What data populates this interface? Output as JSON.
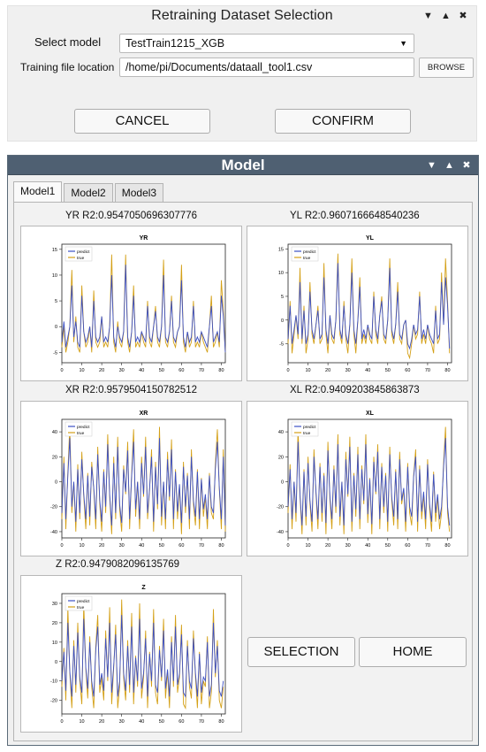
{
  "dataset_window": {
    "title": "Retraining Dataset Selection",
    "select_model_label": "Select model",
    "selected_model": "TestTrain1215_XGB",
    "training_file_label": "Training file location",
    "training_file_value": "/home/pi/Documents/dataall_tool1.csv",
    "browse_label": "BROWSE",
    "cancel_label": "CANCEL",
    "confirm_label": "CONFIRM",
    "window_controls": [
      "chevron-down-icon",
      "chevron-up-icon",
      "close-icon"
    ]
  },
  "model_window": {
    "title": "Model",
    "window_controls": [
      "chevron-down-icon",
      "chevron-up-icon",
      "close-icon"
    ],
    "tabs": [
      {
        "label": "Model1",
        "active": true
      },
      {
        "label": "Model2",
        "active": false
      },
      {
        "label": "Model3",
        "active": false
      }
    ],
    "panels": [
      {
        "r2_label": "YR  R2:0.9547050696307776"
      },
      {
        "r2_label": "YL  R2:0.9607166648540236"
      },
      {
        "r2_label": "XR  R2:0.9579504150782512"
      },
      {
        "r2_label": "XL  R2:0.9409203845863873"
      },
      {
        "r2_label": "Z  R2:0.9479082096135769"
      }
    ],
    "selection_label": "SELECTION",
    "home_label": "HOME"
  },
  "colors": {
    "predict": "#3b4fc4",
    "true": "#d4a017",
    "model_titlebar": "#4f6072"
  },
  "chart_data": [
    {
      "type": "line",
      "title": "YR",
      "legend": [
        "predict",
        "true"
      ],
      "legend_position": "top-left",
      "xlim": [
        0,
        82
      ],
      "ylim": [
        -7,
        16
      ],
      "xticks": [
        0,
        10,
        20,
        30,
        40,
        50,
        60,
        70,
        80
      ],
      "yticks": [
        -5,
        0,
        5,
        10,
        15
      ],
      "series": [
        {
          "name": "predict",
          "values": [
            -3,
            1,
            -4,
            -2,
            0,
            8,
            -2,
            1,
            -3,
            -4,
            6,
            -1,
            -3,
            -2,
            0,
            -4,
            5,
            -2,
            -3,
            -2,
            2,
            -3,
            -2,
            -3,
            0,
            10,
            -2,
            -4,
            0,
            -2,
            -3,
            -1,
            12,
            -2,
            -4,
            -1,
            6,
            -3,
            -2,
            -3,
            -1,
            -2,
            -3,
            4,
            -2,
            -3,
            0,
            3,
            -2,
            -3,
            0,
            10,
            -2,
            -3,
            -1,
            5,
            -2,
            -3,
            -1,
            0,
            9,
            -2,
            -4,
            -1,
            -3,
            -2,
            4,
            -3,
            -2,
            -3,
            -1,
            -2,
            -3,
            -4,
            0,
            4,
            -3,
            -2,
            -1,
            -3,
            6,
            2,
            -5
          ]
        },
        {
          "name": "true",
          "values": [
            -4,
            0,
            -5,
            -3,
            0,
            11,
            -3,
            2,
            -4,
            -5,
            8,
            -1,
            -4,
            -3,
            0,
            -5,
            7,
            -3,
            -4,
            -3,
            2,
            -4,
            -3,
            -4,
            0,
            14,
            -3,
            -5,
            1,
            -3,
            -4,
            -1,
            14,
            -3,
            -5,
            -1,
            8,
            -4,
            -3,
            -4,
            -1,
            -3,
            -4,
            5,
            -3,
            -4,
            0,
            4,
            -3,
            -4,
            0,
            13,
            -3,
            -4,
            -1,
            6,
            -3,
            -4,
            -1,
            0,
            12,
            -3,
            -5,
            -1,
            -4,
            -3,
            5,
            -4,
            -3,
            -4,
            -1,
            -3,
            -4,
            -5,
            0,
            6,
            -4,
            -3,
            -1,
            -4,
            9,
            3,
            -5
          ]
        }
      ]
    },
    {
      "type": "line",
      "title": "YL",
      "legend": [
        "predict",
        "true"
      ],
      "legend_position": "top-left",
      "xlim": [
        0,
        82
      ],
      "ylim": [
        -9,
        16
      ],
      "xticks": [
        0,
        10,
        20,
        30,
        40,
        50,
        60,
        70,
        80
      ],
      "yticks": [
        -5,
        0,
        5,
        10,
        15
      ],
      "series": [
        {
          "name": "predict",
          "values": [
            -4,
            3,
            -5,
            -2,
            1,
            -3,
            8,
            -4,
            2,
            -5,
            -3,
            6,
            -2,
            -4,
            -1,
            2,
            -4,
            -3,
            9,
            -2,
            -5,
            1,
            -3,
            -4,
            0,
            12,
            -2,
            -4,
            3,
            -3,
            -5,
            -1,
            10,
            -2,
            -5,
            0,
            7,
            -4,
            -2,
            -4,
            -1,
            -3,
            -4,
            5,
            -2,
            -4,
            1,
            4,
            -3,
            -4,
            0,
            11,
            -2,
            -4,
            -1,
            6,
            -3,
            -4,
            -1,
            0,
            -5,
            -6,
            -4,
            -1,
            -3,
            -2,
            5,
            -4,
            -2,
            -4,
            -1,
            -3,
            -4,
            -5,
            2,
            -4,
            -3,
            8,
            -1,
            9,
            3,
            -6
          ]
        },
        {
          "name": "true",
          "values": [
            -5,
            4,
            -7,
            -3,
            1,
            -4,
            11,
            -5,
            3,
            -7,
            -4,
            8,
            -3,
            -5,
            -1,
            3,
            -5,
            -4,
            12,
            -3,
            -7,
            1,
            -4,
            -5,
            0,
            14,
            -3,
            -5,
            4,
            -4,
            -7,
            -1,
            13,
            -3,
            -7,
            0,
            9,
            -5,
            -3,
            -5,
            -1,
            -4,
            -5,
            6,
            -3,
            -5,
            1,
            5,
            -4,
            -5,
            0,
            13,
            -3,
            -5,
            -1,
            8,
            -4,
            -5,
            -1,
            0,
            -7,
            -8,
            -5,
            -1,
            -4,
            -3,
            6,
            -5,
            -3,
            -5,
            -1,
            -4,
            -5,
            -7,
            3,
            -5,
            -4,
            10,
            -1,
            13,
            4,
            -7
          ]
        }
      ]
    },
    {
      "type": "line",
      "title": "XR",
      "legend": [
        "predict",
        "true"
      ],
      "legend_position": "top-left",
      "xlim": [
        0,
        82
      ],
      "ylim": [
        -45,
        50
      ],
      "xticks": [
        0,
        10,
        20,
        30,
        40,
        50,
        60,
        70,
        80
      ],
      "yticks": [
        -40,
        -20,
        0,
        20,
        40
      ],
      "series": [
        {
          "name": "predict",
          "values": [
            -25,
            15,
            -30,
            5,
            35,
            -20,
            0,
            -32,
            10,
            -25,
            18,
            -10,
            -30,
            5,
            -28,
            12,
            -5,
            -30,
            22,
            -15,
            -32,
            8,
            -20,
            30,
            -10,
            -35,
            15,
            -25,
            28,
            -18,
            -33,
            10,
            -8,
            25,
            -30,
            5,
            32,
            -22,
            0,
            -30,
            15,
            -10,
            28,
            -25,
            -5,
            20,
            -32,
            12,
            -18,
            35,
            -28,
            0,
            -30,
            18,
            -12,
            26,
            -30,
            8,
            -24,
            -2,
            -33,
            12,
            -20,
            5,
            -30,
            20,
            -15,
            -28,
            8,
            -30,
            2,
            -22,
            -10,
            -30,
            5,
            -20,
            -25,
            10,
            32,
            -5,
            -30,
            20,
            -35
          ]
        },
        {
          "name": "true",
          "values": [
            -30,
            20,
            -38,
            8,
            45,
            -25,
            0,
            -40,
            14,
            -30,
            24,
            -12,
            -38,
            7,
            -35,
            16,
            -6,
            -38,
            28,
            -18,
            -40,
            10,
            -25,
            38,
            -12,
            -42,
            20,
            -30,
            36,
            -22,
            -40,
            13,
            -10,
            32,
            -38,
            7,
            42,
            -28,
            0,
            -38,
            20,
            -12,
            36,
            -30,
            -6,
            26,
            -40,
            16,
            -22,
            44,
            -35,
            0,
            -38,
            24,
            -15,
            34,
            -38,
            10,
            -30,
            -3,
            -42,
            16,
            -25,
            7,
            -38,
            26,
            -18,
            -35,
            10,
            -38,
            3,
            -28,
            -12,
            -38,
            7,
            -25,
            -30,
            14,
            42,
            -6,
            -38,
            26,
            -40
          ]
        }
      ]
    },
    {
      "type": "line",
      "title": "XL",
      "legend": [
        "predict",
        "true"
      ],
      "legend_position": "top-left",
      "xlim": [
        0,
        82
      ],
      "ylim": [
        -45,
        50
      ],
      "xticks": [
        0,
        10,
        20,
        30,
        40,
        50,
        60,
        70,
        80
      ],
      "yticks": [
        -40,
        -20,
        0,
        20,
        40
      ],
      "series": [
        {
          "name": "predict",
          "values": [
            -20,
            10,
            -30,
            0,
            -25,
            32,
            -10,
            -35,
            8,
            -28,
            15,
            -15,
            -32,
            20,
            -8,
            -30,
            12,
            -25,
            5,
            -33,
            25,
            -12,
            -30,
            10,
            -20,
            30,
            -28,
            0,
            -35,
            18,
            -10,
            28,
            -32,
            5,
            -22,
            22,
            -30,
            10,
            -15,
            30,
            -26,
            2,
            -34,
            16,
            -8,
            24,
            -30,
            12,
            -20,
            5,
            -32,
            22,
            -12,
            -28,
            8,
            -30,
            18,
            -15,
            -5,
            -32,
            12,
            -20,
            -28,
            4,
            20,
            -32,
            10,
            -24,
            -8,
            -30,
            14,
            -18,
            -32,
            6,
            -25,
            -10,
            -30,
            -20,
            12,
            35,
            -20,
            -35
          ]
        },
        {
          "name": "true",
          "values": [
            -25,
            14,
            -38,
            0,
            -32,
            44,
            -12,
            -42,
            10,
            -35,
            20,
            -18,
            -40,
            26,
            -10,
            -38,
            15,
            -32,
            7,
            -42,
            32,
            -15,
            -38,
            13,
            -25,
            38,
            -35,
            0,
            -42,
            24,
            -12,
            36,
            -40,
            7,
            -28,
            28,
            -38,
            13,
            -18,
            38,
            -33,
            3,
            -42,
            20,
            -10,
            30,
            -38,
            15,
            -25,
            7,
            -40,
            28,
            -15,
            -35,
            10,
            -38,
            24,
            -18,
            -6,
            -40,
            15,
            -25,
            -35,
            5,
            26,
            -40,
            13,
            -30,
            -10,
            -38,
            18,
            -22,
            -40,
            8,
            -32,
            -12,
            -38,
            -25,
            15,
            44,
            -25,
            -40
          ]
        }
      ]
    },
    {
      "type": "line",
      "title": "Z",
      "legend": [
        "predict",
        "true"
      ],
      "legend_position": "top-left",
      "xlim": [
        0,
        82
      ],
      "ylim": [
        -27,
        35
      ],
      "xticks": [
        0,
        10,
        20,
        30,
        40,
        50,
        60,
        70,
        80
      ],
      "yticks": [
        -20,
        -10,
        0,
        10,
        20,
        30
      ],
      "series": [
        {
          "name": "predict",
          "values": [
            -10,
            5,
            -15,
            20,
            -5,
            -18,
            8,
            -12,
            15,
            -8,
            -16,
            22,
            -3,
            -14,
            10,
            -10,
            -18,
            6,
            18,
            -12,
            -6,
            -15,
            12,
            -8,
            20,
            -16,
            -2,
            14,
            -18,
            -10,
            24,
            -6,
            -15,
            8,
            -12,
            18,
            -16,
            2,
            -10,
            22,
            -14,
            -6,
            12,
            -18,
            4,
            -10,
            20,
            -12,
            -16,
            6,
            -8,
            16,
            -14,
            -4,
            -18,
            10,
            -10,
            18,
            -12,
            -6,
            14,
            -16,
            -18,
            8,
            -10,
            -14,
            12,
            -6,
            -18,
            4,
            -16,
            -8,
            -10,
            10,
            -18,
            -12,
            20,
            -6,
            8,
            -15,
            -18,
            -10
          ]
        },
        {
          "name": "true",
          "values": [
            -13,
            7,
            -20,
            28,
            -6,
            -24,
            11,
            -16,
            20,
            -10,
            -22,
            30,
            -4,
            -19,
            13,
            -13,
            -24,
            8,
            24,
            -16,
            -8,
            -20,
            16,
            -10,
            28,
            -22,
            -3,
            19,
            -24,
            -13,
            32,
            -8,
            -20,
            11,
            -16,
            25,
            -22,
            3,
            -13,
            30,
            -19,
            -8,
            16,
            -24,
            5,
            -13,
            27,
            -16,
            -22,
            8,
            -10,
            22,
            -19,
            -5,
            -24,
            13,
            -13,
            24,
            -16,
            -8,
            19,
            -22,
            -24,
            11,
            -13,
            -19,
            16,
            -8,
            -24,
            5,
            -22,
            -10,
            -13,
            13,
            -24,
            -16,
            27,
            -8,
            11,
            -20,
            -24,
            -13
          ]
        }
      ]
    }
  ]
}
